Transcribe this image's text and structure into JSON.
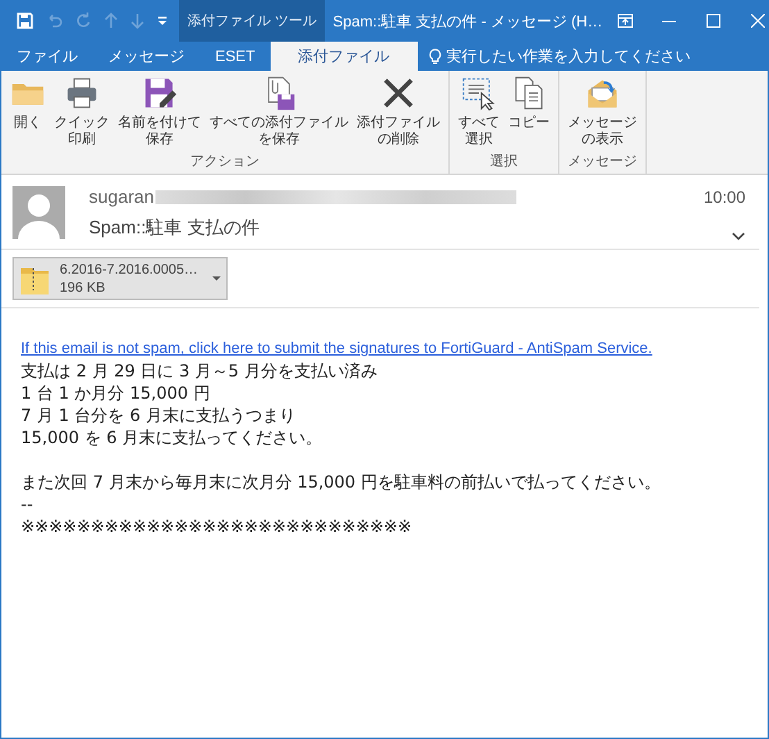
{
  "window": {
    "title": "Spam::駐車  支払の件 - メッセージ (H…",
    "context_group": "添付ファイル ツール"
  },
  "quick_access": [
    {
      "kind": "save",
      "disabled": false
    },
    {
      "kind": "undo",
      "disabled": true
    },
    {
      "kind": "redo",
      "disabled": true
    },
    {
      "kind": "up",
      "disabled": true
    },
    {
      "kind": "down",
      "disabled": true
    },
    {
      "kind": "customize",
      "disabled": false
    }
  ],
  "tabs": [
    {
      "label": "ファイル",
      "selected": false
    },
    {
      "label": "メッセージ",
      "selected": false
    },
    {
      "label": "ESET",
      "selected": false
    },
    {
      "label": "添付ファイル",
      "selected": true
    }
  ],
  "tell_me": {
    "placeholder": "実行したい作業を入力してください"
  },
  "ribbon_groups": [
    {
      "label": "アクション",
      "buttons": [
        {
          "kind": "open",
          "lines": [
            "開く"
          ]
        },
        {
          "kind": "print",
          "lines": [
            "クイック",
            "印刷"
          ]
        },
        {
          "kind": "save-as",
          "lines": [
            "名前を付けて",
            "保存"
          ]
        },
        {
          "kind": "save-all",
          "lines": [
            "すべての添付ファイル",
            "を保存"
          ]
        },
        {
          "kind": "delete",
          "lines": [
            "添付ファイル",
            "の削除"
          ]
        }
      ]
    },
    {
      "label": "選択",
      "buttons": [
        {
          "kind": "select-all",
          "lines": [
            "すべて",
            "選択"
          ]
        },
        {
          "kind": "copy",
          "lines": [
            "コピー"
          ]
        }
      ]
    },
    {
      "label": "メッセージ",
      "buttons": [
        {
          "kind": "show-message",
          "lines": [
            "メッセージ",
            "の表示"
          ]
        }
      ]
    }
  ],
  "header": {
    "sender": "sugaran",
    "time": "10:00",
    "subject": "Spam::駐車  支払の件"
  },
  "attachment": {
    "name": "6.2016-7.2016.0005…",
    "size": "196 KB"
  },
  "body": {
    "link": "If this email is not spam, click here to submit the signatures to FortiGuard - AntiSpam Service.",
    "paragraphs": [
      [
        "支払は 2 月 29 日に 3 月～5 月分を支払い済み",
        "1 台 1 か月分 15,000 円",
        "7 月 1 台分を 6 月末に支払うつまり",
        "15,000 を 6 月末に支払ってください。"
      ],
      [
        "また次回 7 月末から毎月末に次月分 15,000 円を駐車料の前払いで払ってください。",
        "--",
        "※※※※※※※※※※※※※※※※※※※※※※※※※※※※"
      ]
    ]
  }
}
